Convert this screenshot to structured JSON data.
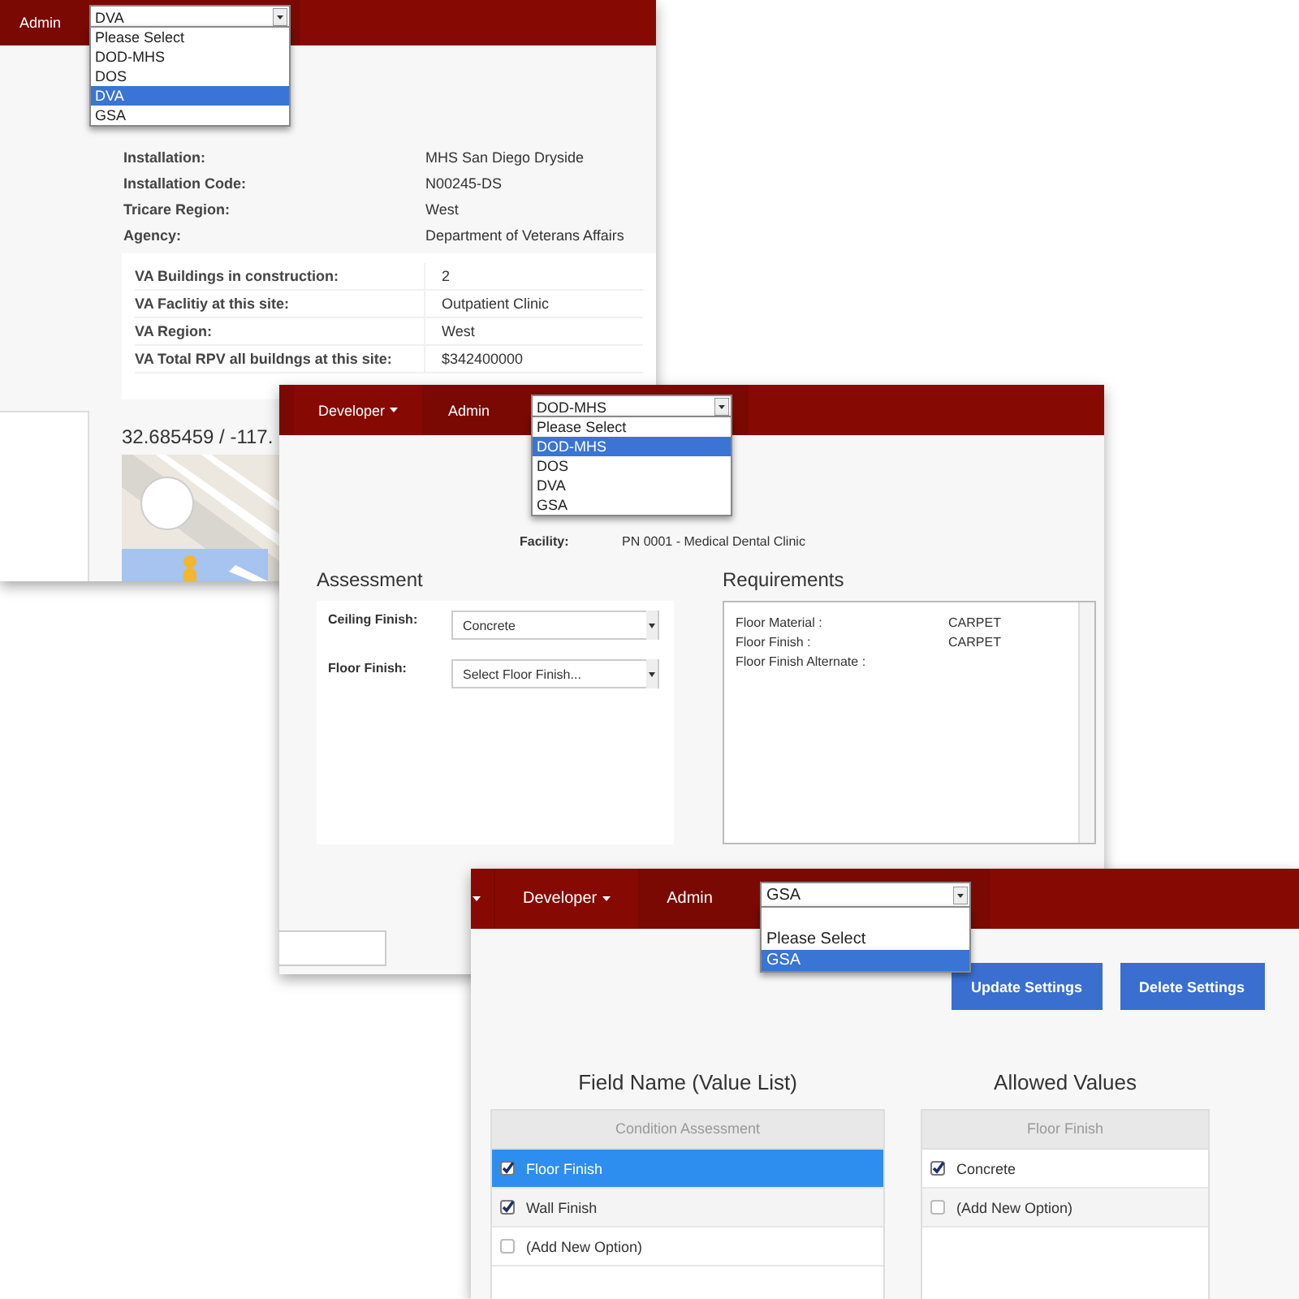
{
  "windows": [
    {
      "kind": "agency",
      "navbar": {
        "items": [
          {
            "label": "Admin",
            "caret": false
          }
        ],
        "select": {
          "value": "DVA",
          "options": [
            {
              "kind": "option",
              "label": "Please Select",
              "selected": false
            },
            {
              "kind": "option",
              "label": "DOD-MHS",
              "selected": false
            },
            {
              "kind": "option",
              "label": "DOS",
              "selected": false
            },
            {
              "kind": "option",
              "label": "DVA",
              "selected": true
            },
            {
              "kind": "option",
              "label": "GSA",
              "selected": false
            }
          ]
        }
      },
      "details": [
        {
          "label": "Installation:",
          "value": "MHS San Diego Dryside"
        },
        {
          "label": "Installation Code:",
          "value": "N00245-DS"
        },
        {
          "label": "Tricare Region:",
          "value": "West"
        },
        {
          "label": "Agency:",
          "value": "Department of Veterans Affairs"
        }
      ],
      "va_details": [
        {
          "label": "VA Buildings in construction:",
          "value": "2"
        },
        {
          "label": "VA Faclitiy at this site:",
          "value": "Outpatient Clinic"
        },
        {
          "label": "VA Region:",
          "value": "West"
        },
        {
          "label": "VA Total RPV all buildngs at this site:",
          "value": "$342400000"
        }
      ],
      "coordinates": "32.685459 / -117.",
      "map": {
        "kind": "picture"
      }
    },
    {
      "kind": "assessment",
      "navbar": {
        "items": [
          {
            "label": "Developer",
            "caret": true
          },
          {
            "label": "Admin",
            "caret": false
          }
        ],
        "select": {
          "value": "DOD-MHS",
          "options": [
            {
              "kind": "option",
              "label": "Please Select",
              "selected": false
            },
            {
              "kind": "option",
              "label": "DOD-MHS",
              "selected": true
            },
            {
              "kind": "option",
              "label": "DOS",
              "selected": false
            },
            {
              "kind": "option",
              "label": "DVA",
              "selected": false
            },
            {
              "kind": "option",
              "label": "GSA",
              "selected": false
            }
          ]
        }
      },
      "facility": {
        "label": "Facility:",
        "value": "PN 0001 - Medical Dental Clinic"
      },
      "assessment": {
        "title": "Assessment",
        "fields": [
          {
            "label": "Ceiling Finish:",
            "value": "Concrete"
          },
          {
            "label": "Floor Finish:",
            "placeholder": "Select Floor Finish..."
          }
        ]
      },
      "requirements": {
        "title": "Requirements",
        "rows": [
          {
            "label": "Floor Material  :",
            "value": "CARPET"
          },
          {
            "label": "Floor Finish  :",
            "value": "CARPET"
          },
          {
            "label": "Floor Finish Alternate  :"
          }
        ]
      }
    },
    {
      "kind": "settings",
      "navbar": {
        "items": [
          {
            "label": "Developer",
            "caret": true
          },
          {
            "label": "Admin",
            "caret": false
          }
        ],
        "select": {
          "value": "GSA",
          "options": [
            {
              "kind": "blank",
              "selected": false
            },
            {
              "kind": "option",
              "label": "Please Select",
              "selected": false
            },
            {
              "kind": "option",
              "label": "GSA",
              "selected": true
            }
          ]
        }
      },
      "buttons": [
        "Update Settings",
        "Delete Settings"
      ],
      "lists": [
        {
          "title": "Field Name (Value List)",
          "header": "Condition Assessment",
          "rows": [
            {
              "label": "Floor Finish",
              "checked": true,
              "selected": true
            },
            {
              "label": "Wall Finish",
              "checked": true,
              "selected": false
            },
            {
              "label": "(Add New Option)",
              "checked": false,
              "selected": false
            }
          ]
        },
        {
          "title": "Allowed Values",
          "header": "Floor Finish",
          "rows": [
            {
              "label": "Concrete",
              "checked": true,
              "selected": false
            },
            {
              "label": "(Add New Option)",
              "checked": false,
              "selected": false
            }
          ]
        }
      ]
    }
  ]
}
